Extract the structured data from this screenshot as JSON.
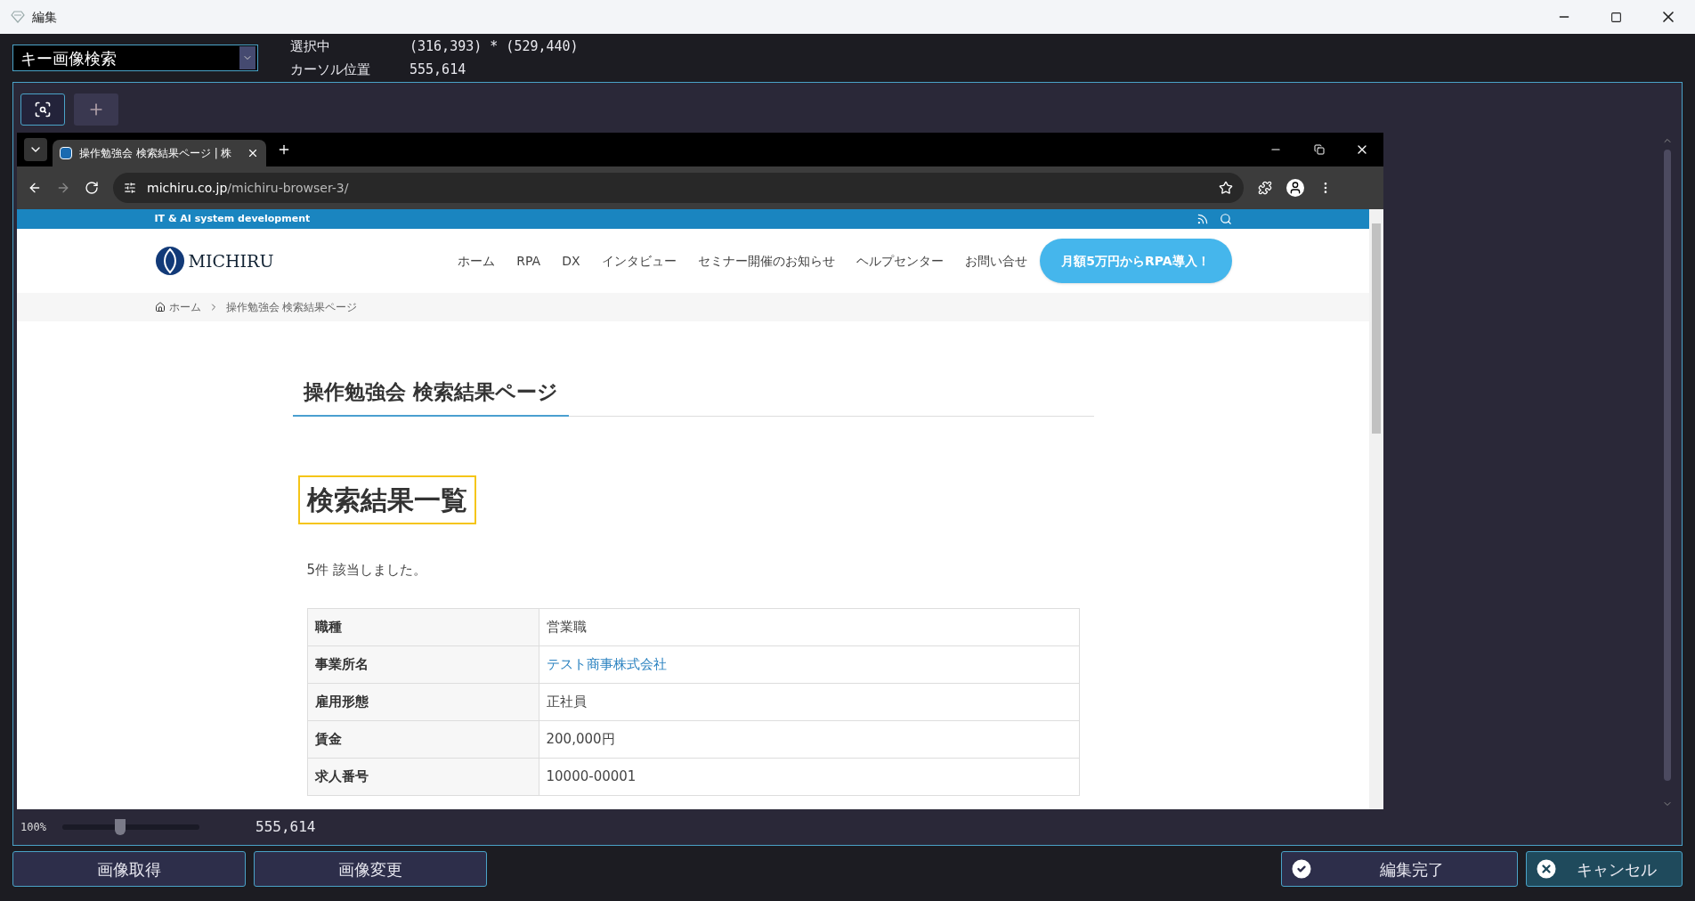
{
  "window": {
    "title": "編集"
  },
  "mode_select": {
    "value": "キー画像検索"
  },
  "info": [
    {
      "label": "選択中",
      "value": "(316,393) * (529,440)"
    },
    {
      "label": "カーソル位置",
      "value": "555,614"
    }
  ],
  "tools": [
    {
      "kind": "zoom",
      "selected": true
    },
    {
      "kind": "crosshair",
      "selected": false
    }
  ],
  "browser": {
    "tab_title": "操作勉強会 検索結果ページ | 株",
    "url_host": "michiru.co.jp",
    "url_path": "/michiru-browser-3/"
  },
  "site": {
    "tagline": "IT & AI system development",
    "logo": "MICHIRU",
    "nav": [
      "ホーム",
      "RPA",
      "DX",
      "インタビュー",
      "セミナー開催のお知らせ",
      "ヘルプセンター",
      "お問い合せ"
    ],
    "cta": "月額5万円からRPA導入！",
    "breadcrumb": [
      "ホーム",
      "操作勉強会 検索結果ページ"
    ],
    "page_title": "操作勉強会 検索結果ページ",
    "section_title": "検索結果一覧",
    "result_count": "5件 該当しました。",
    "table": [
      {
        "label": "職種",
        "value": "営業職",
        "kind": "text"
      },
      {
        "label": "事業所名",
        "value": "テスト商事株式会社",
        "kind": "link"
      },
      {
        "label": "雇用形態",
        "value": "正社員",
        "kind": "text"
      },
      {
        "label": "賃金",
        "value": "200,000円",
        "kind": "text"
      },
      {
        "label": "求人番号",
        "value": "10000-00001",
        "kind": "text"
      }
    ]
  },
  "zoom": {
    "label": "100%",
    "level": 0.42
  },
  "cursor_readout": "555,614",
  "buttons": [
    {
      "label": "画像取得",
      "kind": "plain"
    },
    {
      "label": "画像変更",
      "kind": "plain"
    },
    {
      "label": "編集完了",
      "kind": "confirm"
    },
    {
      "label": "キャンセル",
      "kind": "cancel"
    }
  ]
}
